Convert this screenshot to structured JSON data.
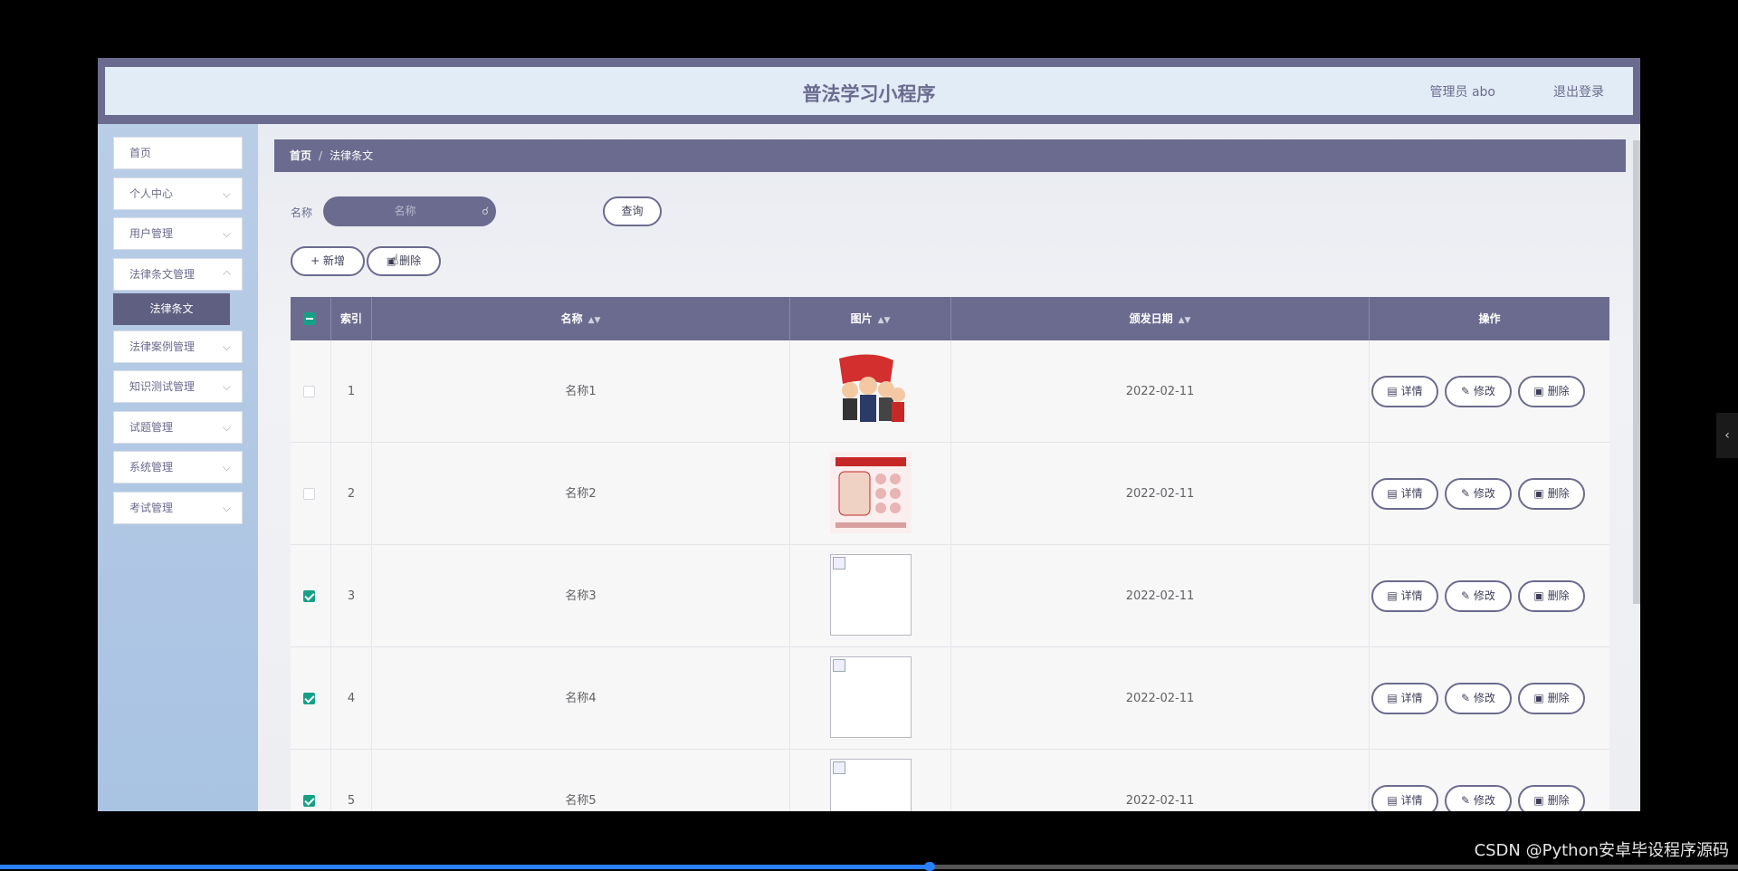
{
  "app": {
    "title": "普法学习小程序",
    "user": "管理员 abo",
    "logout": "退出登录"
  },
  "sidebar": {
    "home": "首页",
    "items": [
      {
        "label": "个人中心"
      },
      {
        "label": "用户管理"
      },
      {
        "label": "法律条文管理"
      },
      {
        "label": "法律案例管理"
      },
      {
        "label": "知识测试管理"
      },
      {
        "label": "试题管理"
      },
      {
        "label": "系统管理"
      },
      {
        "label": "考试管理"
      }
    ],
    "sub_active": "法律条文",
    "chevron": "⌵"
  },
  "breadcrumb": {
    "home": "首页",
    "sep": "/",
    "current": "法律条文"
  },
  "search": {
    "label": "名称",
    "placeholder": "名称",
    "button": "查询"
  },
  "actions": {
    "add": "+ 新增",
    "delete": "删除"
  },
  "table": {
    "headers": {
      "index": "索引",
      "name": "名称",
      "image": "图片",
      "date": "颁发日期",
      "ops": "操作"
    },
    "rows": [
      {
        "index": "1",
        "name": "名称1",
        "date": "2022-02-11",
        "checked": false,
        "image": "cartoon"
      },
      {
        "index": "2",
        "name": "名称2",
        "date": "2022-02-11",
        "checked": false,
        "image": "poster"
      },
      {
        "index": "3",
        "name": "名称3",
        "date": "2022-02-11",
        "checked": true,
        "image": "broken"
      },
      {
        "index": "4",
        "name": "名称4",
        "date": "2022-02-11",
        "checked": true,
        "image": "broken"
      },
      {
        "index": "5",
        "name": "名称5",
        "date": "2022-02-11",
        "checked": true,
        "image": "broken"
      }
    ],
    "row_buttons": {
      "detail": "详情",
      "edit": "修改",
      "delete": "删除"
    }
  },
  "colors": {
    "accent": "#6b6b8f",
    "check": "#16a085",
    "sidebar": "#afc7e5"
  },
  "player": {
    "watermark": "CSDN @Python安卓毕设程序源码",
    "progress": 0.535
  }
}
